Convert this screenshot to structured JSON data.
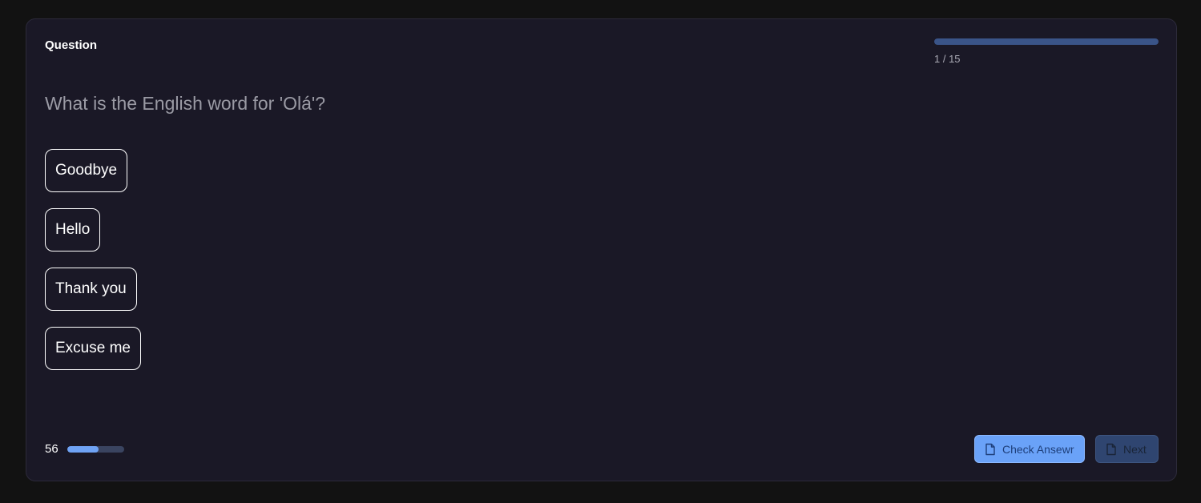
{
  "header": {
    "section_label": "Question",
    "progress_text": "1 / 15",
    "progress_fraction": 1.0
  },
  "question": {
    "text": "What is the English word for 'Olá'?"
  },
  "options": [
    {
      "label": "Goodbye"
    },
    {
      "label": "Hello"
    },
    {
      "label": "Thank you"
    },
    {
      "label": "Excuse me"
    }
  ],
  "footer": {
    "score": "56",
    "score_fraction": 0.56,
    "check_label": "Check Ansewr",
    "next_label": "Next",
    "icon": "document-icon"
  },
  "colors": {
    "background": "#121212",
    "card": "#1a1826",
    "accent": "#6aa2f8",
    "disabled": "#2f4570"
  }
}
